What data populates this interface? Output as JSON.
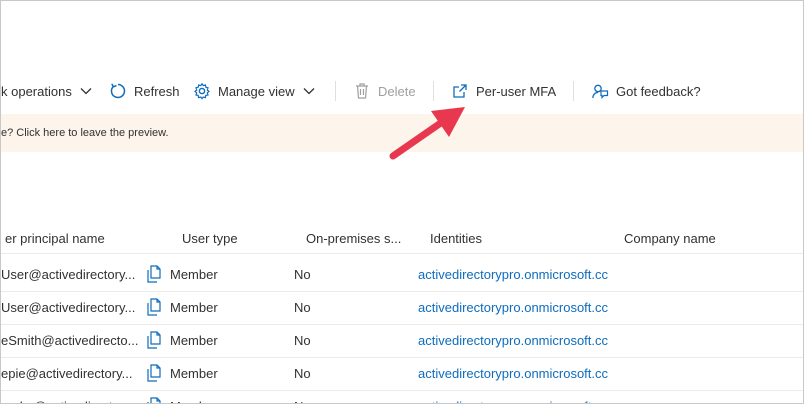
{
  "toolbar": {
    "bulk_label": "k operations",
    "refresh_label": "Refresh",
    "manage_view_label": "Manage view",
    "delete_label": "Delete",
    "per_user_mfa_label": "Per-user MFA",
    "feedback_label": "Got feedback?"
  },
  "banner": {
    "text": "e? Click here to leave the preview."
  },
  "table": {
    "headers": [
      "er principal name",
      "User type",
      "On-premises s...",
      "Identities",
      "Company name"
    ],
    "rows": [
      {
        "upn": "User@activedirectory...",
        "type": "Member",
        "onprem": "No",
        "identity": "activedirectorypro.onmicrosoft.cc"
      },
      {
        "upn": "User@activedirectory...",
        "type": "Member",
        "onprem": "No",
        "identity": "activedirectorypro.onmicrosoft.cc"
      },
      {
        "upn": "eSmith@activedirecto...",
        "type": "Member",
        "onprem": "No",
        "identity": "activedirectorypro.onmicrosoft.cc"
      },
      {
        "upn": "epie@activedirectory...",
        "type": "Member",
        "onprem": "No",
        "identity": "activedirectorypro.onmicrosoft.cc"
      },
      {
        "upn": "_adm@activedirecto...",
        "type": "Member",
        "onprem": "No",
        "identity": "activedirectorypro.onmicrosoft.cc"
      }
    ]
  },
  "colors": {
    "accent": "#0f6cbd",
    "banner_bg": "#fdf4eb",
    "arrow": "#e8384f",
    "disabled": "#a19f9d"
  }
}
